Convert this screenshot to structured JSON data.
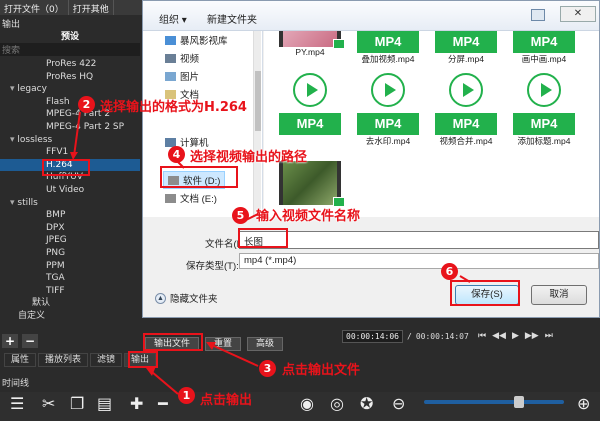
{
  "app": {
    "menu": [
      "打开文件（0）",
      "打开其他"
    ],
    "panel_title": "输出",
    "preset_header": "预设",
    "search_placeholder": "搜索",
    "tree": [
      {
        "label": "ProRes 422",
        "level": 2
      },
      {
        "label": "ProRes HQ",
        "level": 2
      },
      {
        "label": "legacy",
        "level": 1,
        "expanded": true
      },
      {
        "label": "Flash",
        "level": 2
      },
      {
        "label": "MPEG-4 Part 2",
        "level": 2
      },
      {
        "label": "MPEG-4 Part 2 SP",
        "level": 2
      },
      {
        "label": "lossless",
        "level": 1,
        "expanded": true
      },
      {
        "label": "FFV1",
        "level": 2
      },
      {
        "label": "H.264",
        "level": 2,
        "selected": true
      },
      {
        "label": "HuffYUV",
        "level": 2
      },
      {
        "label": "Ut Video",
        "level": 2
      },
      {
        "label": "stills",
        "level": 1,
        "expanded": true
      },
      {
        "label": "BMP",
        "level": 2
      },
      {
        "label": "DPX",
        "level": 2
      },
      {
        "label": "JPEG",
        "level": 2
      },
      {
        "label": "PNG",
        "level": 2
      },
      {
        "label": "PPM",
        "level": 2
      },
      {
        "label": "TGA",
        "level": 2
      },
      {
        "label": "TIFF",
        "level": 2
      },
      {
        "label": "默认",
        "level": 1
      },
      {
        "label": "自定义",
        "level": 0
      }
    ],
    "add_label": "+",
    "remove_label": "−",
    "export_file": "输出文件",
    "reset": "重置",
    "advanced": "高级",
    "timecode_current": "00:00:14:06",
    "timecode_total": "00:00:14:07",
    "tabs": [
      "属性",
      "播放列表",
      "滤镜",
      "输出"
    ],
    "active_tab": "输出",
    "timeline_label": "时间线",
    "accent_color": "#1d5b93"
  },
  "dialog": {
    "organize": "组织 ▾",
    "new_folder": "新建文件夹",
    "nav": {
      "storm": "暴风影视库",
      "videos": "视频",
      "pictures": "图片",
      "documents": "文档",
      "computer": "计算机",
      "drive_d": "软件 (D:)",
      "drive_e": "文档 (E:)"
    },
    "files": [
      {
        "name": "PY.mp4",
        "kind": "thumb-pink"
      },
      {
        "name": "叠加视频.mp4",
        "kind": "mp4-top"
      },
      {
        "name": "分屏.mp4",
        "kind": "mp4-top"
      },
      {
        "name": "画中画.mp4",
        "kind": "mp4-top"
      },
      {
        "name": "",
        "kind": "mp4"
      },
      {
        "name": "去水印.mp4",
        "kind": "mp4"
      },
      {
        "name": "视频合并.mp4",
        "kind": "mp4"
      },
      {
        "name": "添加标题.mp4",
        "kind": "mp4"
      },
      {
        "name": "",
        "kind": "thumb"
      }
    ],
    "mp4_badge": "MP4",
    "filename_label": "文件名(N):",
    "filename_value": "长图",
    "filetype_label": "保存类型(T):",
    "filetype_value": "mp4 (*.mp4)",
    "hide_folders": "隐藏文件夹",
    "save": "保存(S)",
    "cancel": "取消",
    "close": "✕"
  },
  "annotations": [
    {
      "num": "1",
      "text": "点击输出"
    },
    {
      "num": "2",
      "text": "选择输出的格式为H.264"
    },
    {
      "num": "3",
      "text": "点击输出文件"
    },
    {
      "num": "4",
      "text": "选择视频输出的路径"
    },
    {
      "num": "5",
      "text": "输入视频文件名称"
    },
    {
      "num": "6",
      "text": ""
    }
  ],
  "annotation_color": "#e8131b",
  "mp4_color": "#22b14c"
}
